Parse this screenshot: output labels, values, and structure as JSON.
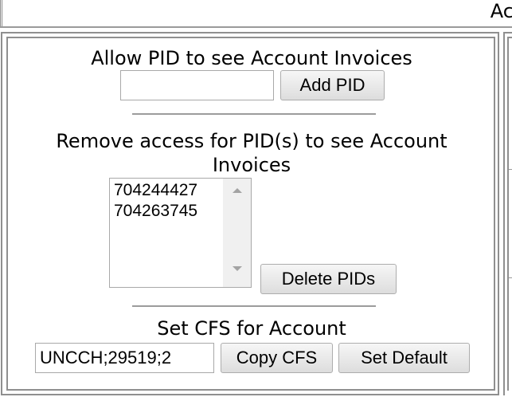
{
  "header": {
    "partial_title": "Ac"
  },
  "allow_section": {
    "label": "Allow PID to see Account Invoices",
    "pid_input_value": "",
    "add_button_label": "Add PID"
  },
  "remove_section": {
    "label_line1": "Remove access for PID(s) to see Account",
    "label_line2": "Invoices",
    "pids": [
      "704244427",
      "704263745"
    ],
    "delete_button_label": "Delete PIDs"
  },
  "cfs_section": {
    "label": "Set CFS for Account",
    "cfs_input_value": "UNCCH;29519;2",
    "copy_button_label": "Copy CFS",
    "default_button_label": "Set Default"
  },
  "colors": {
    "border": "#8f8f8f",
    "button_top": "#f6f6f6",
    "button_bottom": "#dddddd",
    "scrollbar": "#f0f0f0"
  },
  "icons": {
    "scroll_up": "arrow-up-icon",
    "scroll_down": "arrow-down-icon"
  }
}
